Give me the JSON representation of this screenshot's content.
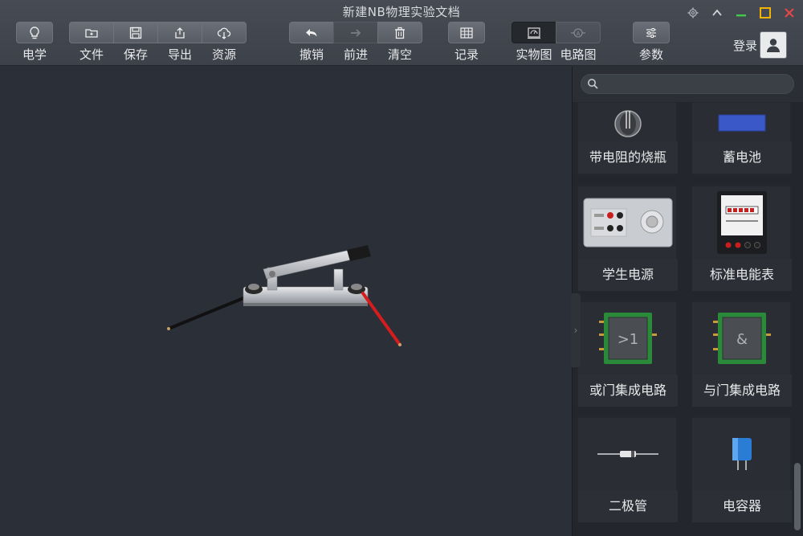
{
  "window": {
    "title": "新建NB物理实验文档"
  },
  "toolbar": {
    "electricity": "电学",
    "file": "文件",
    "save": "保存",
    "export": "导出",
    "resources": "资源",
    "undo": "撤销",
    "redo": "前进",
    "clear": "清空",
    "record": "记录",
    "view_real": "实物图",
    "view_circuit": "电路图",
    "params": "参数",
    "login": "登录"
  },
  "search": {
    "placeholder": "",
    "value": ""
  },
  "components": [
    {
      "label": "带电阻的烧瓶"
    },
    {
      "label": "蓄电池"
    },
    {
      "label": "学生电源"
    },
    {
      "label": "标准电能表"
    },
    {
      "label": "或门集成电路",
      "chip_text": ">1"
    },
    {
      "label": "与门集成电路",
      "chip_text": "&"
    },
    {
      "label": "二极管"
    },
    {
      "label": "电容器"
    }
  ],
  "colors": {
    "accent_min": "#41c94a",
    "accent_max": "#f2b200",
    "close": "#e24747",
    "wire_red": "#d61c1c"
  }
}
